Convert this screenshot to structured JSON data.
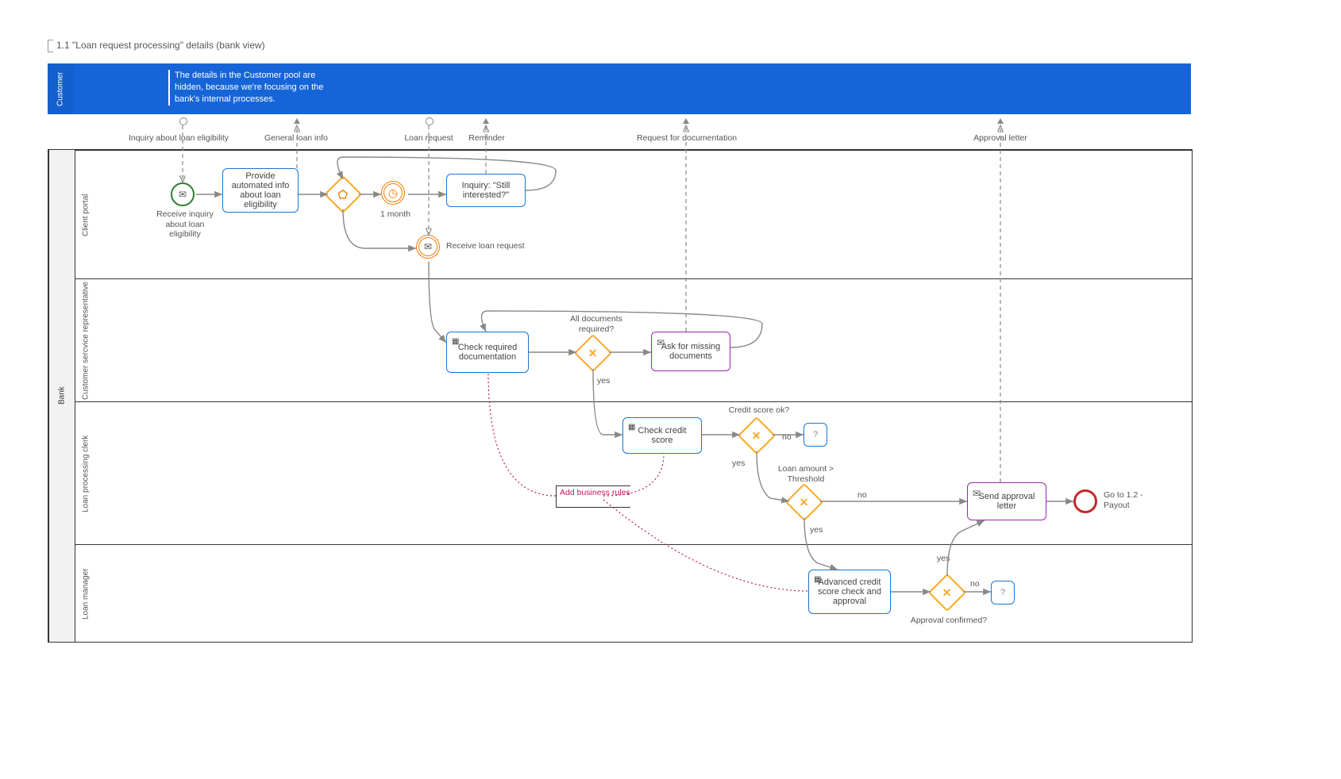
{
  "title": "1.1 \"Loan request processing\" details (bank view)",
  "pools": {
    "customer": {
      "name": "Customer",
      "note": "The details in the Customer pool are hidden, because we're focusing on the bank's internal processes."
    },
    "bank": {
      "name": "Bank",
      "lanes": {
        "lane1": "Client portal",
        "lane2": "Customer sercvice representative",
        "lane3": "Loan processing clerk",
        "lane4": "Loan manager"
      }
    }
  },
  "messages": {
    "m1": "Inquiry about loan eligibility",
    "m2": "General loan info",
    "m3": "Loan request",
    "m4": "Reminder",
    "m5": "Request for documentation",
    "m6": "Approval letter"
  },
  "nodes": {
    "start_event": "Receive inquiry about loan eligibility",
    "task_info": "Provide automated info about loan eligibility",
    "timer_label": "1 month",
    "task_inquiry": "Inquiry: \"Still interested?\"",
    "event_loanreq": "Receive loan request",
    "task_checkdoc": "Check required documentation",
    "gw_docs": "All documents required?",
    "task_askdocs": "Ask for missing documents",
    "task_creditscore": "Check credit score",
    "gw_score": "Credit score ok?",
    "gw_thresh": "Loan amount > Threshold",
    "task_approval": "Send approval letter",
    "end_label": "Go to 1.2 - Payout",
    "task_advanced": "Advanced credit score check and approval",
    "gw_confirm": "Approval confirmed?",
    "q": "?"
  },
  "edges": {
    "yes": "yes",
    "no": "no"
  },
  "annotation": "Add business rules"
}
